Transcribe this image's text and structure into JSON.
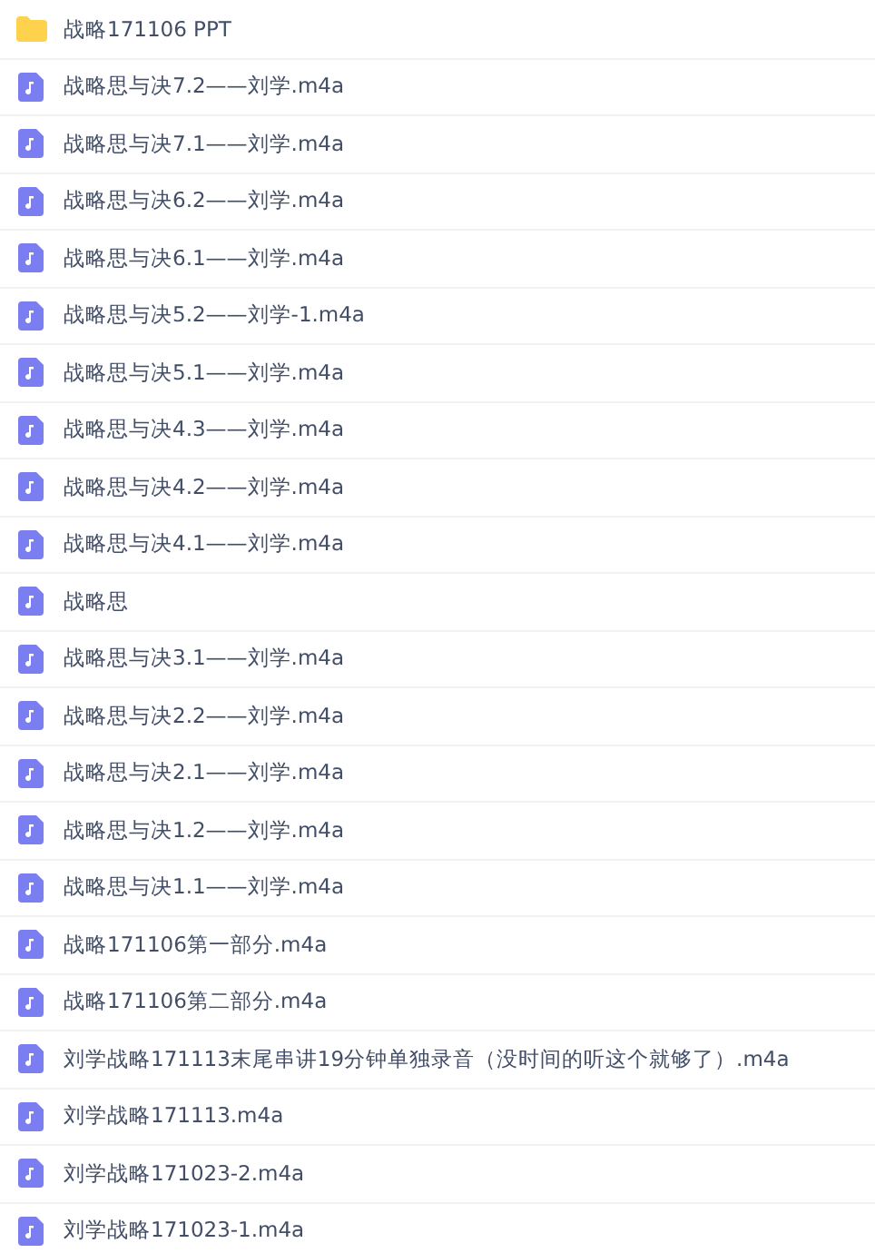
{
  "files": [
    {
      "kind": "folder",
      "name": "战略171106 PPT"
    },
    {
      "kind": "audio",
      "name": "战略思与决7.2——刘学.m4a"
    },
    {
      "kind": "audio",
      "name": "战略思与决7.1——刘学.m4a"
    },
    {
      "kind": "audio",
      "name": "战略思与决6.2——刘学.m4a"
    },
    {
      "kind": "audio",
      "name": "战略思与决6.1——刘学.m4a"
    },
    {
      "kind": "audio",
      "name": "战略思与决5.2——刘学-1.m4a"
    },
    {
      "kind": "audio",
      "name": "战略思与决5.1——刘学.m4a"
    },
    {
      "kind": "audio",
      "name": "战略思与决4.3——刘学.m4a"
    },
    {
      "kind": "audio",
      "name": "战略思与决4.2——刘学.m4a"
    },
    {
      "kind": "audio",
      "name": "战略思与决4.1——刘学.m4a"
    },
    {
      "kind": "audio",
      "name": "战略思"
    },
    {
      "kind": "audio",
      "name": "战略思与决3.1——刘学.m4a"
    },
    {
      "kind": "audio",
      "name": "战略思与决2.2——刘学.m4a"
    },
    {
      "kind": "audio",
      "name": "战略思与决2.1——刘学.m4a"
    },
    {
      "kind": "audio",
      "name": "战略思与决1.2——刘学.m4a"
    },
    {
      "kind": "audio",
      "name": "战略思与决1.1——刘学.m4a"
    },
    {
      "kind": "audio",
      "name": "战略171106第一部分.m4a"
    },
    {
      "kind": "audio",
      "name": "战略171106第二部分.m4a"
    },
    {
      "kind": "audio",
      "name": "刘学战略171113末尾串讲19分钟单独录音（没时间的听这个就够了）.m4a"
    },
    {
      "kind": "audio",
      "name": "刘学战略171113.m4a"
    },
    {
      "kind": "audio",
      "name": "刘学战略171023-2.m4a"
    },
    {
      "kind": "audio",
      "name": "刘学战略171023-1.m4a"
    }
  ]
}
